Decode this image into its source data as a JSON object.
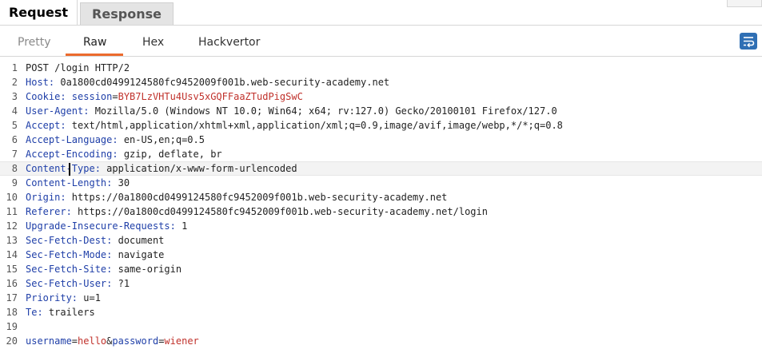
{
  "top_tabs": {
    "request": "Request",
    "response": "Response"
  },
  "sub_tabs": {
    "pretty": "Pretty",
    "raw": "Raw",
    "hex": "Hex",
    "hackvertor": "Hackvertor"
  },
  "icons": {
    "wrap_toggle": "word-wrap-icon"
  },
  "colors": {
    "accent_underline": "#ec6b2d",
    "header_name": "#1f3fa8",
    "value_red": "#c0312b",
    "icon_blue": "#2f6fb4"
  },
  "request_lines": [
    {
      "num": "1",
      "plain": "POST /login HTTP/2"
    },
    {
      "num": "2",
      "name": "Host:",
      "value": " 0a1800cd0499124580fc9452009f001b.web-security-academy.net"
    },
    {
      "num": "3",
      "name": "Cookie:",
      "cookie_key": " session",
      "sep": "=",
      "cookie_val": "BYB7LzVHTu4Usv5xGQFFaaZTudPigSwC"
    },
    {
      "num": "4",
      "name": "User-Agent:",
      "value": " Mozilla/5.0 (Windows NT 10.0; Win64; x64; rv:127.0) Gecko/20100101 Firefox/127.0"
    },
    {
      "num": "5",
      "name": "Accept:",
      "value": " text/html,application/xhtml+xml,application/xml;q=0.9,image/avif,image/webp,*/*;q=0.8"
    },
    {
      "num": "6",
      "name": "Accept-Language:",
      "value": " en-US,en;q=0.5"
    },
    {
      "num": "7",
      "name": "Accept-Encoding:",
      "value": " gzip, deflate, br"
    },
    {
      "num": "8",
      "name": "Content-Type:",
      "value": " application/x-www-form-urlencoded"
    },
    {
      "num": "9",
      "name": "Content-Length:",
      "value": " 30"
    },
    {
      "num": "10",
      "name": "Origin:",
      "value": " https://0a1800cd0499124580fc9452009f001b.web-security-academy.net"
    },
    {
      "num": "11",
      "name": "Referer:",
      "value": " https://0a1800cd0499124580fc9452009f001b.web-security-academy.net/login"
    },
    {
      "num": "12",
      "name": "Upgrade-Insecure-Requests:",
      "value": " 1"
    },
    {
      "num": "13",
      "name": "Sec-Fetch-Dest:",
      "value": " document"
    },
    {
      "num": "14",
      "name": "Sec-Fetch-Mode:",
      "value": " navigate"
    },
    {
      "num": "15",
      "name": "Sec-Fetch-Site:",
      "value": " same-origin"
    },
    {
      "num": "16",
      "name": "Sec-Fetch-User:",
      "value": " ?1"
    },
    {
      "num": "17",
      "name": "Priority:",
      "value": " u=1"
    },
    {
      "num": "18",
      "name": "Te:",
      "value": " trailers"
    },
    {
      "num": "19",
      "plain": ""
    },
    {
      "num": "20",
      "body": [
        {
          "k": "username",
          "v": "hello"
        },
        {
          "k": "password",
          "v": "wiener"
        }
      ]
    }
  ]
}
